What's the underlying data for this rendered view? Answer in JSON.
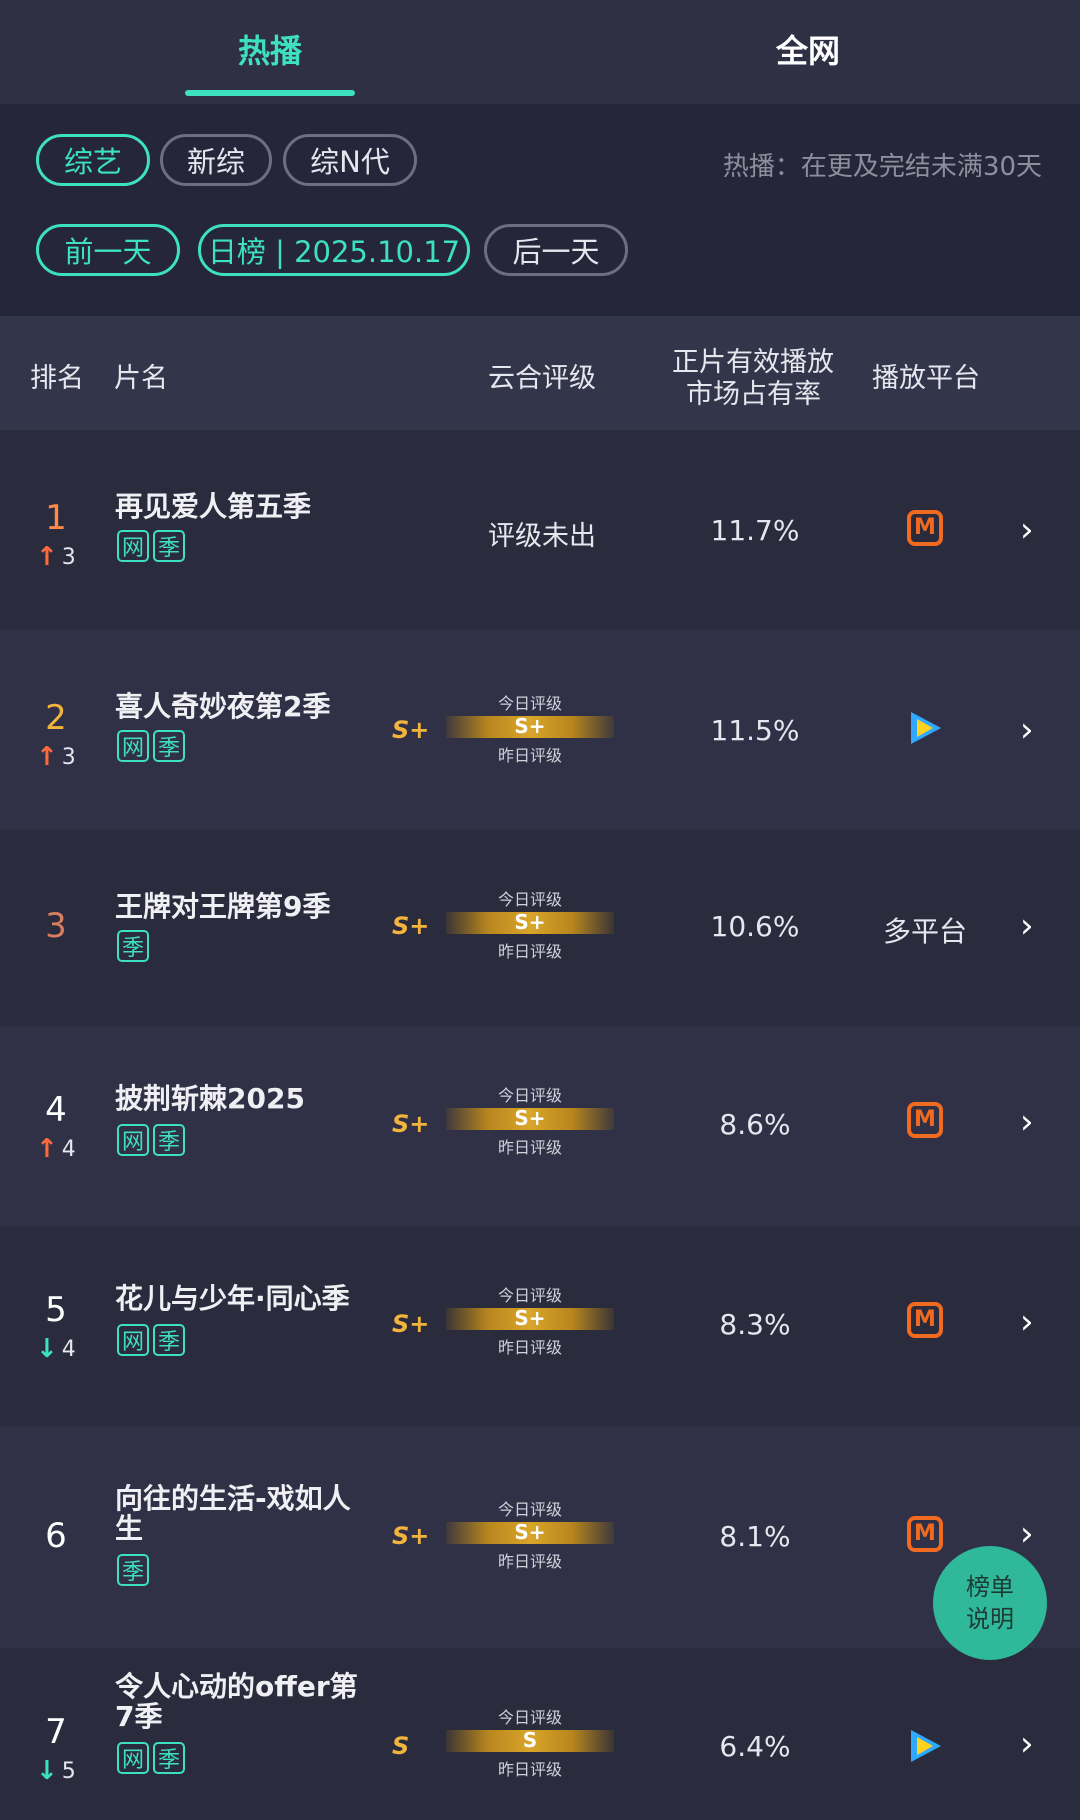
{
  "tabs": [
    {
      "label": "热播",
      "active": true
    },
    {
      "label": "全网",
      "active": false
    }
  ],
  "filters": {
    "categories": [
      {
        "label": "综艺",
        "active": true
      },
      {
        "label": "新综",
        "active": false
      },
      {
        "label": "综N代",
        "active": false
      }
    ],
    "hint": "热播：在更及完结未满30天",
    "prev_day": "前一天",
    "date_label": "日榜 | 2025.10.17",
    "next_day": "后一天"
  },
  "table_header": {
    "rank": "排名",
    "name": "片名",
    "rating": "云合评级",
    "share_line1": "正片有效播放",
    "share_line2": "市场占有率",
    "platform": "播放平台"
  },
  "rating_labels": {
    "today": "今日评级",
    "yesterday": "昨日评级"
  },
  "rows": [
    {
      "rank": "1",
      "trend": "up",
      "trend_value": "3",
      "title": "再见爱人第五季",
      "tags": [
        "网",
        "季"
      ],
      "rating": "",
      "rating_text": "评级未出",
      "share": "11.7%",
      "platform": "mgtv-icon"
    },
    {
      "rank": "2",
      "trend": "up",
      "trend_value": "3",
      "title": "喜人奇妙夜第2季",
      "tags": [
        "网",
        "季"
      ],
      "rating": "S+",
      "share": "11.5%",
      "platform": "tencent-video-icon"
    },
    {
      "rank": "3",
      "trend": "",
      "trend_value": "",
      "title": "王牌对王牌第9季",
      "tags": [
        "季"
      ],
      "rating": "S+",
      "share": "10.6%",
      "platform": "多平台"
    },
    {
      "rank": "4",
      "trend": "up",
      "trend_value": "4",
      "title": "披荆斩棘2025",
      "tags": [
        "网",
        "季"
      ],
      "rating": "S+",
      "share": "8.6%",
      "platform": "mgtv-icon"
    },
    {
      "rank": "5",
      "trend": "down",
      "trend_value": "4",
      "title": "花儿与少年·同心季",
      "tags": [
        "网",
        "季"
      ],
      "rating": "S+",
      "share": "8.3%",
      "platform": "mgtv-icon"
    },
    {
      "rank": "6",
      "trend": "",
      "trend_value": "",
      "title": "向往的生活-戏如人生",
      "tags": [
        "季"
      ],
      "rating": "S+",
      "share": "8.1%",
      "platform": "mgtv-icon"
    },
    {
      "rank": "7",
      "trend": "down",
      "trend_value": "5",
      "title": "令人心动的offer第7季",
      "tags": [
        "网",
        "季"
      ],
      "rating": "S",
      "share": "6.4%",
      "platform": "tencent-video-icon"
    }
  ],
  "fab": {
    "line1": "榜单",
    "line2": "说明"
  },
  "colors": {
    "accent": "#3de0c0",
    "up": "#ff6a3d",
    "rating_gold": "#f2b43c",
    "mgtv": "#f06a20"
  }
}
